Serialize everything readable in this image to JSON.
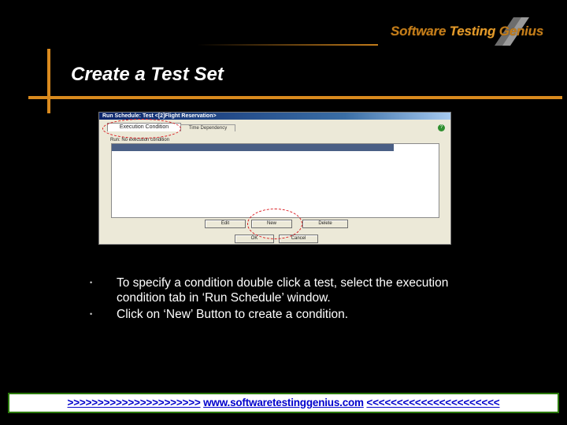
{
  "logo": {
    "word1": "Software",
    "word2": "Testing",
    "word3": "Genius"
  },
  "title": "Create a Test Set",
  "dialog": {
    "window_title": "Run Schedule: Test <[2]Flight Reservation>",
    "tabs": [
      "Execution Condition",
      "Time Dependency"
    ],
    "condition_label": "Run: No execution condition",
    "buttons": {
      "edit": "Edit",
      "new": "New",
      "delete": "Delete",
      "ok": "OK",
      "cancel": "Cancel"
    }
  },
  "bullets": [
    "To specify a condition double click a test, select the execution condition tab in ‘Run Schedule’ window.",
    "Click on ‘New’ Button to create a condition."
  ],
  "footer": {
    "left_arrows": ">>>>>>>>>>>>>>>>>>>>>>",
    "link": "www.softwaretestinggenius.com",
    "right_arrows": "<<<<<<<<<<<<<<<<<<<<<<"
  },
  "colors": {
    "background": "#000000",
    "accent_orange": "#d98a1e",
    "highlight_red": "#d9181e",
    "footer_text_blue": "#0000cc",
    "footer_border_green": "#2b7a0b"
  }
}
